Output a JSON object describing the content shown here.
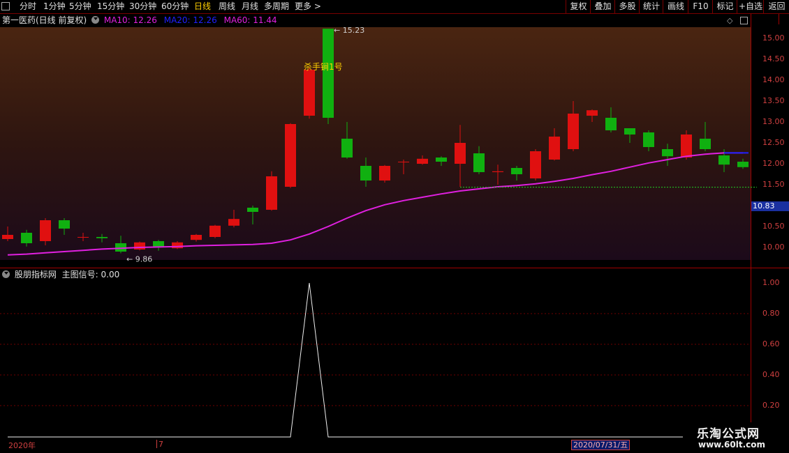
{
  "toolbar": {
    "left": [
      {
        "label": "分时",
        "active": false
      },
      {
        "label": "1分钟",
        "active": false
      },
      {
        "label": "5分钟",
        "active": false
      },
      {
        "label": "15分钟",
        "active": false
      },
      {
        "label": "30分钟",
        "active": false
      },
      {
        "label": "60分钟",
        "active": false
      },
      {
        "label": "日线",
        "active": true
      },
      {
        "label": "周线",
        "active": false
      },
      {
        "label": "月线",
        "active": false
      },
      {
        "label": "多周期",
        "active": false
      },
      {
        "label": "更多 >",
        "active": false
      }
    ],
    "right": [
      "复权",
      "叠加",
      "多股",
      "统计",
      "画线",
      "F10",
      "标记",
      "+自选",
      "返回"
    ]
  },
  "main": {
    "title": "第一医药(日线 前复权)",
    "ma10": "MA10: 12.26",
    "ma20": "MA20: 12.26",
    "ma60": "MA60: 11.44",
    "high_marker": "15.23",
    "low_marker": "9.86",
    "signal_text": "杀手锏1号",
    "current_price": "10.83",
    "colors": {
      "up": "#e01010",
      "down": "#10b010",
      "ma60": "#e020e0",
      "ma20": "#2020ff"
    }
  },
  "sub": {
    "title": "股朋指标网",
    "signal_label": "主图信号: 0.00"
  },
  "axis_main": [
    "15.00",
    "14.50",
    "14.00",
    "13.50",
    "13.00",
    "12.50",
    "12.00",
    "11.50",
    "10.50",
    "10.00"
  ],
  "axis_sub": [
    "1.00",
    "0.80",
    "0.60",
    "0.40",
    "0.20"
  ],
  "dates": {
    "start": "2020年",
    "mid": "7",
    "cursor": "2020/07/31/五"
  },
  "watermark": {
    "title": "乐淘公式网",
    "url": "www.60lt.com"
  },
  "chart_data": {
    "type": "candlestick",
    "ylim": [
      9.7,
      15.3
    ],
    "candles": [
      {
        "o": 10.2,
        "c": 10.3,
        "h": 10.5,
        "l": 10.15
      },
      {
        "o": 10.35,
        "c": 10.1,
        "h": 10.42,
        "l": 10.02
      },
      {
        "o": 10.15,
        "c": 10.65,
        "h": 10.7,
        "l": 10.05
      },
      {
        "o": 10.65,
        "c": 10.45,
        "h": 10.7,
        "l": 10.3
      },
      {
        "o": 10.25,
        "c": 10.25,
        "h": 10.35,
        "l": 10.15
      },
      {
        "o": 10.25,
        "c": 10.22,
        "h": 10.32,
        "l": 10.12
      },
      {
        "o": 10.1,
        "c": 9.9,
        "h": 10.28,
        "l": 9.86
      },
      {
        "o": 9.95,
        "c": 10.12,
        "h": 10.14,
        "l": 9.93
      },
      {
        "o": 10.15,
        "c": 10.0,
        "h": 10.18,
        "l": 9.92
      },
      {
        "o": 9.98,
        "c": 10.12,
        "h": 10.15,
        "l": 9.96
      },
      {
        "o": 10.18,
        "c": 10.3,
        "h": 10.32,
        "l": 10.14
      },
      {
        "o": 10.25,
        "c": 10.52,
        "h": 10.54,
        "l": 10.22
      },
      {
        "o": 10.52,
        "c": 10.68,
        "h": 10.9,
        "l": 10.48
      },
      {
        "o": 10.95,
        "c": 10.85,
        "h": 11.0,
        "l": 10.55
      },
      {
        "o": 10.9,
        "c": 11.7,
        "h": 11.82,
        "l": 10.88
      },
      {
        "o": 11.45,
        "c": 12.95,
        "h": 12.97,
        "l": 11.42
      },
      {
        "o": 13.15,
        "c": 14.25,
        "h": 14.3,
        "l": 13.08
      },
      {
        "o": 15.23,
        "c": 13.1,
        "h": 15.23,
        "l": 12.95
      },
      {
        "o": 12.6,
        "c": 12.15,
        "h": 13.0,
        "l": 12.12
      },
      {
        "o": 11.95,
        "c": 11.6,
        "h": 12.15,
        "l": 11.45
      },
      {
        "o": 11.6,
        "c": 11.95,
        "h": 11.97,
        "l": 11.55
      },
      {
        "o": 12.05,
        "c": 12.05,
        "h": 12.1,
        "l": 11.75
      },
      {
        "o": 12.0,
        "c": 12.12,
        "h": 12.2,
        "l": 11.98
      },
      {
        "o": 12.15,
        "c": 12.05,
        "h": 12.18,
        "l": 11.95
      },
      {
        "o": 12.0,
        "c": 12.5,
        "h": 12.93,
        "l": 11.45
      },
      {
        "o": 12.25,
        "c": 11.8,
        "h": 12.42,
        "l": 11.75
      },
      {
        "o": 11.8,
        "c": 11.82,
        "h": 11.98,
        "l": 11.5
      },
      {
        "o": 11.9,
        "c": 11.75,
        "h": 11.95,
        "l": 11.6
      },
      {
        "o": 11.65,
        "c": 12.3,
        "h": 12.35,
        "l": 11.6
      },
      {
        "o": 12.1,
        "c": 12.65,
        "h": 12.85,
        "l": 12.08
      },
      {
        "o": 12.35,
        "c": 13.2,
        "h": 13.5,
        "l": 12.3
      },
      {
        "o": 13.15,
        "c": 13.28,
        "h": 13.3,
        "l": 13.0
      },
      {
        "o": 13.1,
        "c": 12.8,
        "h": 13.35,
        "l": 12.75
      },
      {
        "o": 12.85,
        "c": 12.7,
        "h": 12.85,
        "l": 12.5
      },
      {
        "o": 12.75,
        "c": 12.4,
        "h": 12.8,
        "l": 12.3
      },
      {
        "o": 12.35,
        "c": 12.18,
        "h": 12.48,
        "l": 11.95
      },
      {
        "o": 12.15,
        "c": 12.7,
        "h": 12.8,
        "l": 12.1
      },
      {
        "o": 12.6,
        "c": 12.35,
        "h": 13.0,
        "l": 12.3
      },
      {
        "o": 12.2,
        "c": 11.98,
        "h": 12.35,
        "l": 11.8
      },
      {
        "o": 12.05,
        "c": 11.92,
        "h": 12.12,
        "l": 11.88
      }
    ],
    "ma60": [
      9.82,
      9.84,
      9.87,
      9.9,
      9.93,
      9.96,
      9.98,
      10.0,
      10.01,
      10.02,
      10.04,
      10.05,
      10.06,
      10.07,
      10.1,
      10.18,
      10.32,
      10.5,
      10.7,
      10.88,
      11.02,
      11.12,
      11.2,
      11.28,
      11.35,
      11.4,
      11.45,
      11.48,
      11.52,
      11.58,
      11.65,
      11.74,
      11.82,
      11.92,
      12.02,
      12.1,
      12.18,
      12.23,
      12.26,
      12.26
    ],
    "signal": [
      0,
      0,
      0,
      0,
      0,
      0,
      0,
      0,
      0,
      0,
      0,
      0,
      0,
      0,
      0,
      0,
      1,
      0,
      0,
      0,
      0,
      0,
      0,
      0,
      0,
      0,
      0,
      0,
      0,
      0,
      0,
      0,
      0,
      0,
      0,
      0,
      0,
      0,
      0,
      0
    ],
    "signal_ylim": [
      0,
      1.1
    ],
    "dashed_level": 11.44
  }
}
